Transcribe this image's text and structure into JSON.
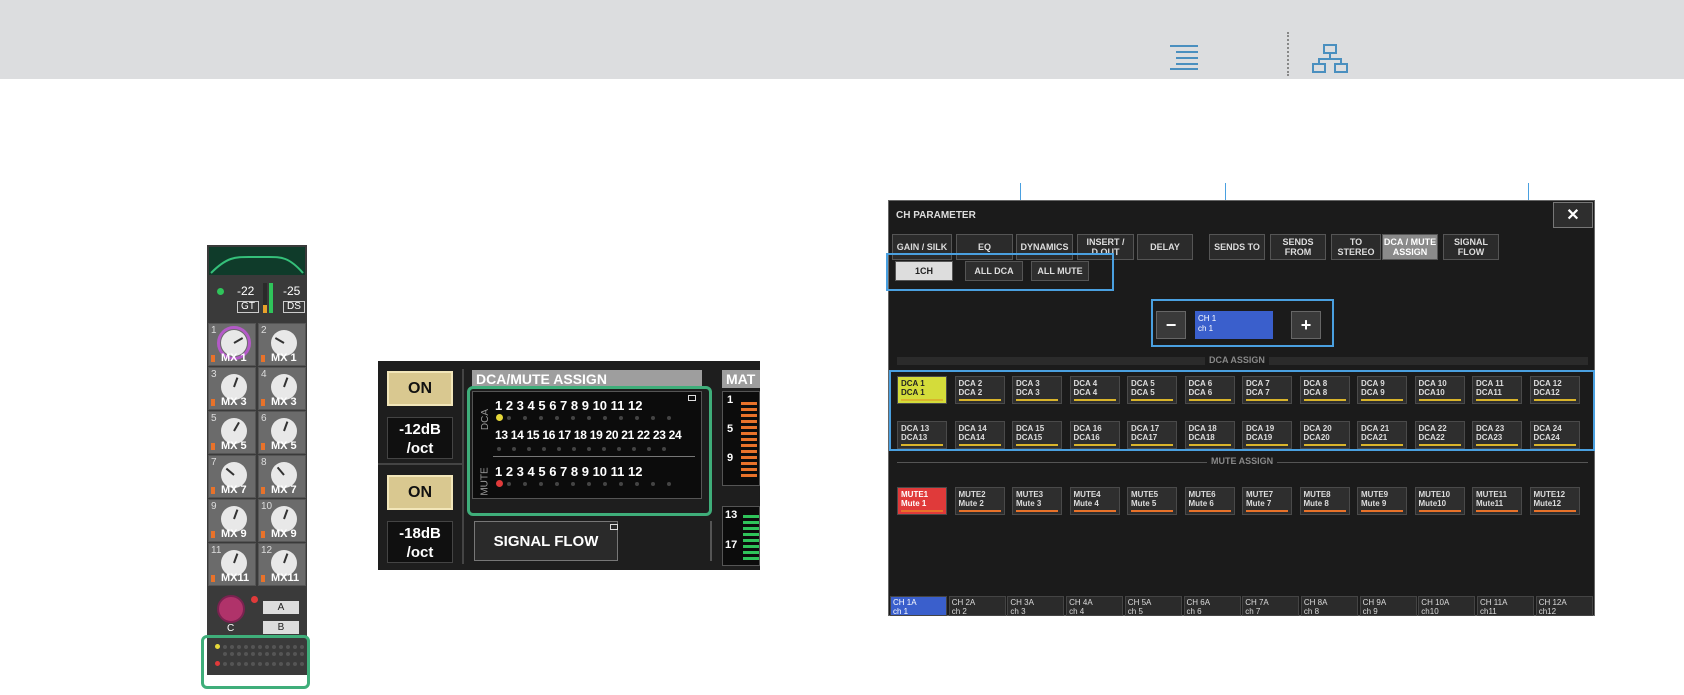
{
  "strip": {
    "gate_value": "-22",
    "dyn_value": "-25",
    "gate_tag": "GT",
    "dyn_tag": "DS",
    "knobs": [
      {
        "num": "1",
        "label": "MX 1"
      },
      {
        "num": "2",
        "label": "MX 1"
      },
      {
        "num": "3",
        "label": "MX 3"
      },
      {
        "num": "4",
        "label": "MX 3"
      },
      {
        "num": "5",
        "label": "MX 5"
      },
      {
        "num": "6",
        "label": "MX 5"
      },
      {
        "num": "7",
        "label": "MX 7"
      },
      {
        "num": "8",
        "label": "MX 7"
      },
      {
        "num": "9",
        "label": "MX 9"
      },
      {
        "num": "10",
        "label": "MX 9"
      },
      {
        "num": "11",
        "label": "MX11"
      },
      {
        "num": "12",
        "label": "MX11"
      }
    ],
    "pan_label": "C",
    "a_label": "A",
    "b_label": "B"
  },
  "mid": {
    "on1": "ON",
    "val1a": "-12dB",
    "val1b": "/oct",
    "on2": "ON",
    "val2a": "-18dB",
    "val2b": "/oct",
    "title": "DCA/MUTE ASSIGN",
    "dca_label": "DCA",
    "mute_label": "MUTE",
    "row1": "1 2 3 4 5 6 7 8 9 10 11 12",
    "row2": "13 14 15 16 17 18 19 20 21 22 23 24",
    "row3": "1 2 3 4 5 6 7 8 9 10 11 12",
    "signal_flow": "SIGNAL FLOW",
    "mat_title": "MAT",
    "mat_nums": [
      "1",
      "5",
      "9",
      "13",
      "17"
    ]
  },
  "dialog": {
    "title": "CH PARAMETER",
    "close": "✕",
    "tabs": [
      "GAIN / SILK",
      "EQ",
      "DYNAMICS",
      "INSERT / D.OUT",
      "DELAY",
      "SENDS TO",
      "SENDS FROM",
      "TO STEREO",
      "DCA / MUTE ASSIGN",
      "SIGNAL FLOW"
    ],
    "subtabs": [
      "1CH",
      "ALL DCA",
      "ALL MUTE"
    ],
    "minus": "−",
    "plus": "+",
    "ch_top": "CH 1",
    "ch_bottom": "ch 1",
    "dca_section": "DCA ASSIGN",
    "mute_section": "MUTE ASSIGN",
    "dca": [
      [
        "DCA 1",
        "DCA 1"
      ],
      [
        "DCA 2",
        "DCA 2"
      ],
      [
        "DCA 3",
        "DCA 3"
      ],
      [
        "DCA 4",
        "DCA 4"
      ],
      [
        "DCA 5",
        "DCA 5"
      ],
      [
        "DCA 6",
        "DCA 6"
      ],
      [
        "DCA 7",
        "DCA 7"
      ],
      [
        "DCA 8",
        "DCA 8"
      ],
      [
        "DCA 9",
        "DCA 9"
      ],
      [
        "DCA 10",
        "DCA10"
      ],
      [
        "DCA 11",
        "DCA11"
      ],
      [
        "DCA 12",
        "DCA12"
      ],
      [
        "DCA 13",
        "DCA13"
      ],
      [
        "DCA 14",
        "DCA14"
      ],
      [
        "DCA 15",
        "DCA15"
      ],
      [
        "DCA 16",
        "DCA16"
      ],
      [
        "DCA 17",
        "DCA17"
      ],
      [
        "DCA 18",
        "DCA18"
      ],
      [
        "DCA 19",
        "DCA19"
      ],
      [
        "DCA 20",
        "DCA20"
      ],
      [
        "DCA 21",
        "DCA21"
      ],
      [
        "DCA 22",
        "DCA22"
      ],
      [
        "DCA 23",
        "DCA23"
      ],
      [
        "DCA 24",
        "DCA24"
      ]
    ],
    "mute": [
      [
        "MUTE1",
        "Mute 1"
      ],
      [
        "MUTE2",
        "Mute 2"
      ],
      [
        "MUTE3",
        "Mute 3"
      ],
      [
        "MUTE4",
        "Mute 4"
      ],
      [
        "MUTE5",
        "Mute 5"
      ],
      [
        "MUTE6",
        "Mute 6"
      ],
      [
        "MUTE7",
        "Mute 7"
      ],
      [
        "MUTE8",
        "Mute 8"
      ],
      [
        "MUTE9",
        "Mute 9"
      ],
      [
        "MUTE10",
        "Mute10"
      ],
      [
        "MUTE11",
        "Mute11"
      ],
      [
        "MUTE12",
        "Mute12"
      ]
    ],
    "channels": [
      [
        "CH 1A",
        "ch 1"
      ],
      [
        "CH 2A",
        "ch 2"
      ],
      [
        "CH 3A",
        "ch 3"
      ],
      [
        "CH 4A",
        "ch 4"
      ],
      [
        "CH 5A",
        "ch 5"
      ],
      [
        "CH 6A",
        "ch 6"
      ],
      [
        "CH 7A",
        "ch 7"
      ],
      [
        "CH 8A",
        "ch 8"
      ],
      [
        "CH 9A",
        "ch 9"
      ],
      [
        "CH 10A",
        "ch10"
      ],
      [
        "CH 11A",
        "ch11"
      ],
      [
        "CH 12A",
        "ch12"
      ]
    ]
  },
  "colors": {
    "dca_on": "#d4dc3a",
    "mute_on": "#e03a3a",
    "ch_selected": "#3a5fcc",
    "highlight": "#4aa0e0",
    "green_frame": "#3fae7a"
  }
}
